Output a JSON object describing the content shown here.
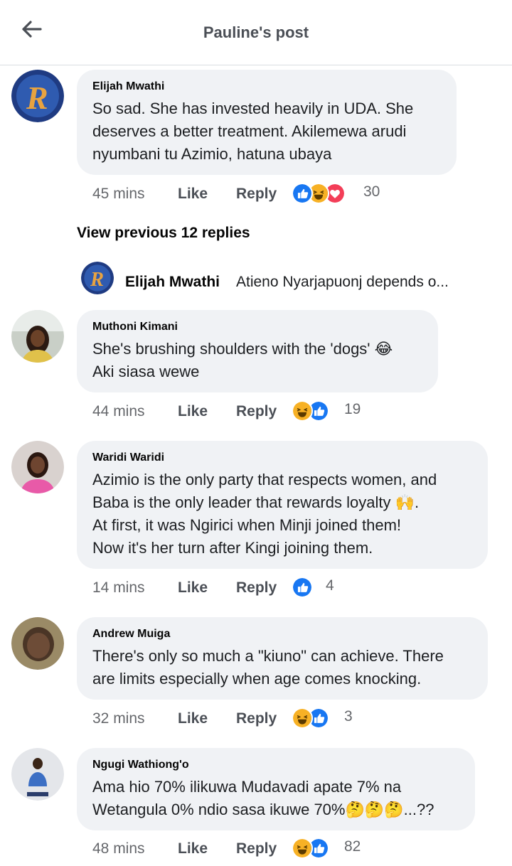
{
  "header": {
    "title": "Pauline's post"
  },
  "comments": [
    {
      "name": "Elijah Mwathi",
      "text": "So sad. She has invested heavily in UDA. She\ndeserves a better treatment. Akilemewa arudi\nnyumbani tu Azimio, hatuna ubaya",
      "time": "45 mins",
      "like": "Like",
      "reply": "Reply",
      "reactions": [
        "like-icon",
        "haha-icon",
        "love-icon"
      ],
      "count": "30"
    },
    {
      "name": "Muthoni Kimani",
      "text": "She's brushing shoulders with the 'dogs' 😂\nAki siasa wewe",
      "time": "44 mins",
      "like": "Like",
      "reply": "Reply",
      "reactions": [
        "haha-icon",
        "like-icon"
      ],
      "count": "19"
    },
    {
      "name": "Waridi Waridi",
      "text": "Azimio is the only party that respects women, and\nBaba is the only leader that rewards loyalty 🙌.\nAt first, it was Ngirici when Minji joined them!\nNow it's her turn after Kingi joining them.",
      "time": "14 mins",
      "like": "Like",
      "reply": "Reply",
      "reactions": [
        "like-icon"
      ],
      "count": "4"
    },
    {
      "name": "Andrew Muiga",
      "text": "There's only so much a \"kiuno\" can achieve. There\nare limits especially when age comes knocking.",
      "time": "32 mins",
      "like": "Like",
      "reply": "Reply",
      "reactions": [
        "haha-icon",
        "like-icon"
      ],
      "count": "3"
    },
    {
      "name": "Ngugi Wathiong'o",
      "text": "Ama hio 70% ilikuwa Mudavadi apate 7% na\nWetangula 0% ndio sasa ikuwe 70%🤔🤔🤔...??",
      "time": "48 mins",
      "like": "Like",
      "reply": "Reply",
      "reactions": [
        "haha-icon",
        "like-icon"
      ],
      "count": "82"
    }
  ],
  "view_previous": "View previous 12 replies",
  "reply_preview": {
    "name": "Elijah Mwathi",
    "text": "Atieno Nyarjapuonj depends o..."
  },
  "colors": {
    "like": "#1877f2",
    "love": "#f33e58",
    "haha": "#f7b125",
    "bubble": "#f0f2f5"
  }
}
